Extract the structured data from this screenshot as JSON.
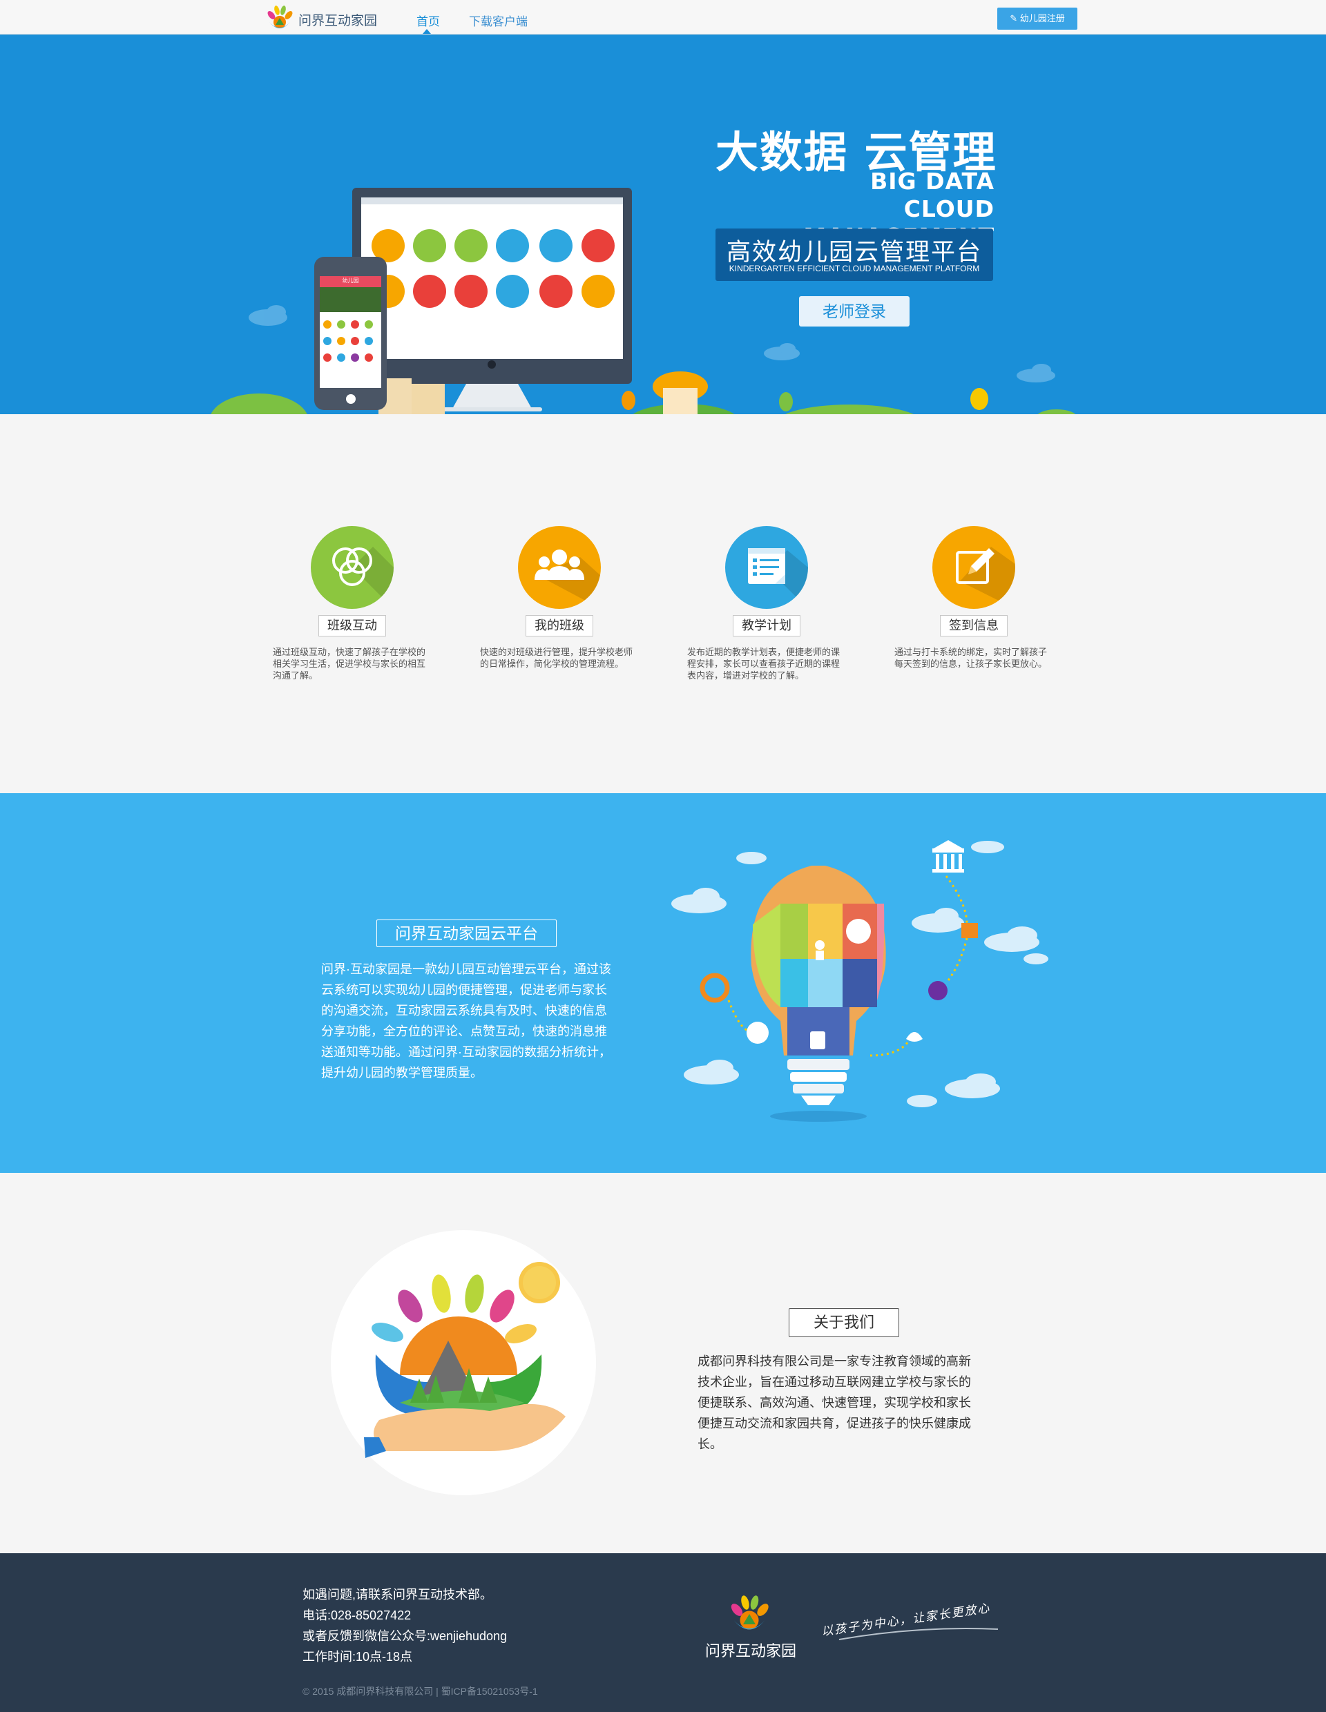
{
  "nav": {
    "brand": "问界互动家园",
    "links": [
      "首页",
      "下载客户端"
    ],
    "register_label": "幼儿园注册",
    "register_icon": "pencil-icon"
  },
  "hero": {
    "title": "大数据  云管理",
    "title_en_line1": "BIG DATA",
    "title_en_line2": "CLOUD MANAGEMENT",
    "subtitle": "高效幼儿园云管理平台",
    "subtitle_en": "KINDERGARTEN EFFICIENT CLOUD MANAGEMENT PLATFORM",
    "login_button": "老师登录",
    "phone_header": "幼儿园"
  },
  "features": [
    {
      "label": "班级互动",
      "desc": "通过班级互动，快速了解孩子在学校的相关学习生活，促进学校与家长的相互沟通了解。",
      "color": "#8cc63f",
      "icon": "circles-icon"
    },
    {
      "label": "我的班级",
      "desc": "快速的对班级进行管理，提升学校老师的日常操作，简化学校的管理流程。",
      "color": "#f7a600",
      "icon": "users-icon"
    },
    {
      "label": "教学计划",
      "desc": "发布近期的教学计划表，便捷老师的课程安排，家长可以查看孩子近期的课程表内容，增进对学校的了解。",
      "color": "#2ea7e0",
      "icon": "document-icon"
    },
    {
      "label": "签到信息",
      "desc": "通过与打卡系统的绑定，实时了解孩子每天签到的信息，让孩子家长更放心。",
      "color": "#f7a600",
      "icon": "edit-icon"
    }
  ],
  "platform": {
    "title": "问界互动家园云平台",
    "desc": "问界·互动家园是一款幼儿园互动管理云平台，通过该云系统可以实现幼儿园的便捷管理，促进老师与家长的沟通交流，互动家园云系统具有及时、快速的信息分享功能，全方位的评论、点赞互动，快速的消息推送通知等功能。通过问界·互动家园的数据分析统计，提升幼儿园的教学管理质量。"
  },
  "about": {
    "title": "关于我们",
    "desc": "成都问界科技有限公司是一家专注教育领域的高新技术企业，旨在通过移动互联网建立学校与家长的便捷联系、高效沟通、快速管理，实现学校和家长便捷互动交流和家园共育，促进孩子的快乐健康成长。"
  },
  "footer": {
    "lines": [
      "如遇问题,请联系问界互动技术部。",
      "电话:028-85027422",
      "或者反馈到微信公众号:wenjiehudong",
      "工作时间:10点-18点"
    ],
    "brand": "问界互动家园",
    "slogan": "以孩子为中心，让家长更放心",
    "copyright": "© 2015 成都问界科技有限公司 | 蜀ICP备15021053号-1"
  },
  "colors": {
    "hero_bg": "#1a8fd8",
    "platform_bg": "#3db3ef",
    "footer_bg": "#2a3a4d",
    "accent": "#3aa4e6"
  }
}
